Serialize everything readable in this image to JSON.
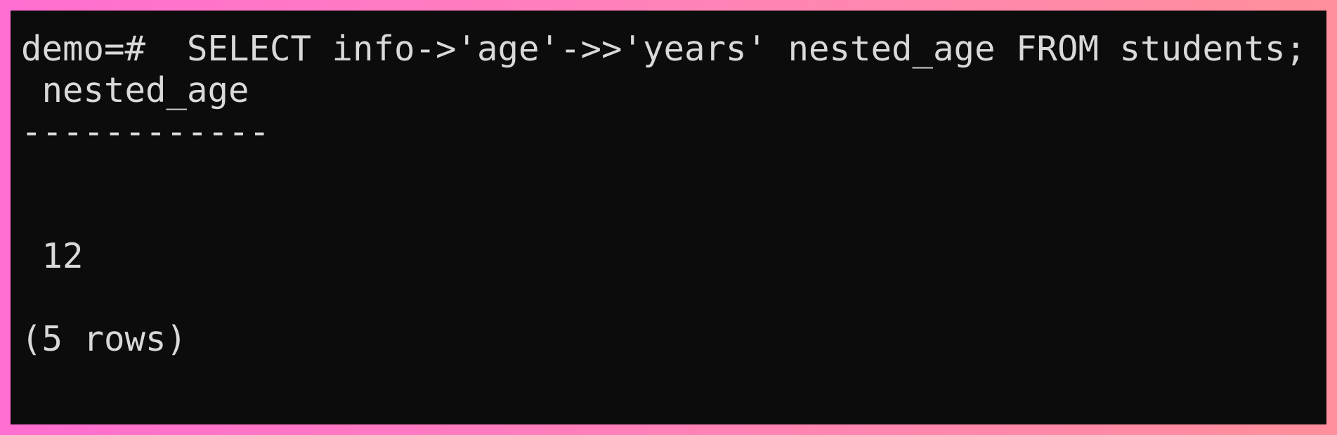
{
  "terminal": {
    "lines": [
      "demo=#  SELECT info->'age'->>'years' nested_age FROM students;",
      " nested_age",
      "------------",
      "",
      "",
      " 12",
      "",
      "(5 rows)"
    ]
  }
}
